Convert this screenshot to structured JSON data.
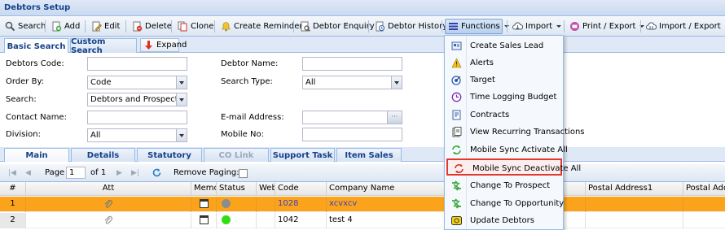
{
  "window": {
    "title": "Debtors Setup"
  },
  "toolbar": {
    "search": "Search",
    "add": "Add",
    "edit": "Edit",
    "delete": "Delete",
    "clone": "Clone",
    "create_reminder": "Create Reminder",
    "debtor_enquiry": "Debtor Enquiry",
    "debtor_history": "Debtor History",
    "functions": "Functions",
    "import": "Import",
    "print_export": "Print / Export",
    "import_export": "Import / Export"
  },
  "search_tabs": {
    "basic": "Basic Search",
    "custom": "Custom Search",
    "expand": "Expand"
  },
  "form": {
    "debtors_code_label": "Debtors Code:",
    "debtors_code_value": "",
    "debtor_name_label": "Debtor Name:",
    "debtor_name_value": "",
    "order_by_label": "Order By:",
    "order_by_value": "Code",
    "search_type_label": "Search Type:",
    "search_type_value": "All",
    "search_label": "Search:",
    "search_value": "Debtors and Prospects L",
    "contact_name_label": "Contact Name:",
    "contact_name_value": "",
    "email_label": "E-mail Address:",
    "email_value": "",
    "email_trigger": "···",
    "division_label": "Division:",
    "division_value": "All",
    "mobile_label": "Mobile No:",
    "mobile_value": ""
  },
  "detail_tabs": [
    "Main",
    "Details",
    "Statutory",
    "CO Link",
    "Support Task",
    "Item Sales"
  ],
  "pager": {
    "page_label": "Page",
    "page_value": "1",
    "of_label": "of 1",
    "remove_paging_label": "Remove Paging:"
  },
  "grid": {
    "columns": [
      "#",
      "Att",
      "Memo",
      "Status",
      "Web",
      "Code",
      "Company Name",
      "Postal Address1",
      "Postal Addre"
    ],
    "rows": [
      {
        "num": "1",
        "code": "1028",
        "company": "xcvxcv",
        "status_color": "#8c8c8c"
      },
      {
        "num": "2",
        "code": "1042",
        "company": "test 4",
        "status_color": "#33dd11"
      }
    ]
  },
  "functions_menu": {
    "items": [
      {
        "label": "Create Sales Lead",
        "icon": "sales-lead-icon"
      },
      {
        "label": "Alerts",
        "icon": "alert-icon"
      },
      {
        "label": "Target",
        "icon": "target-icon"
      },
      {
        "label": "Time Logging Budget",
        "icon": "time-logging-icon"
      },
      {
        "label": "Contracts",
        "icon": "contracts-icon"
      },
      {
        "label": "View Recurring Transactions",
        "icon": "recurring-icon"
      },
      {
        "label": "Mobile Sync Activate All",
        "icon": "sync-activate-icon"
      },
      {
        "label": "Mobile Sync Deactivate All",
        "icon": "sync-deactivate-icon"
      },
      {
        "label": "Change To Prospect",
        "icon": "change-prospect-icon"
      },
      {
        "label": "Change To Opportunity",
        "icon": "change-opportunity-icon"
      },
      {
        "label": "Update Debtors",
        "icon": "update-debtors-icon"
      }
    ],
    "highlighted_index": 7
  },
  "colors": {
    "selected_row": "#fba41b",
    "highlight_border": "#e2382f",
    "header_text": "#15428b"
  }
}
